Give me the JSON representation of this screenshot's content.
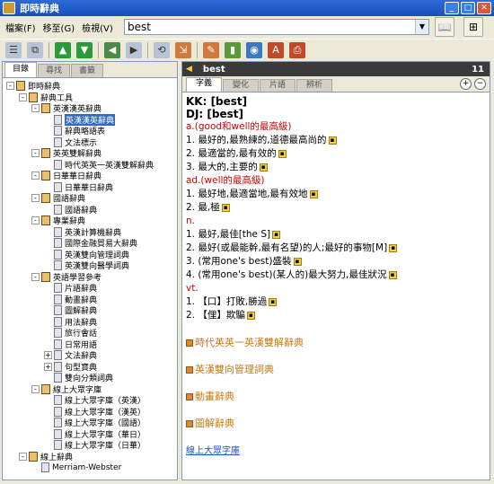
{
  "window": {
    "title": "即時辭典"
  },
  "menu": {
    "items": [
      "檔案(F)",
      "移至(G)",
      "檢視(V)"
    ]
  },
  "search": {
    "value": "best"
  },
  "left_tabs": [
    "目錄",
    "尋找",
    "書籤"
  ],
  "tree": [
    {
      "label": "即時辭典",
      "level": 0,
      "exp": "-",
      "icon": "book"
    },
    {
      "label": "辭典工具",
      "level": 1,
      "exp": "-",
      "icon": "book"
    },
    {
      "label": "英漢漢英辭典",
      "level": 2,
      "exp": "-",
      "icon": "book"
    },
    {
      "label": "英漢漢英辭典",
      "level": 3,
      "icon": "page",
      "selected": true
    },
    {
      "label": "辭典略語表",
      "level": 3,
      "icon": "page"
    },
    {
      "label": "文法標示",
      "level": 3,
      "icon": "page"
    },
    {
      "label": "英英雙解辭典",
      "level": 2,
      "exp": "-",
      "icon": "book"
    },
    {
      "label": "時代英英一英漢雙解辭典",
      "level": 3,
      "icon": "page"
    },
    {
      "label": "日華華日辭典",
      "level": 2,
      "exp": "-",
      "icon": "book"
    },
    {
      "label": "日華華日辭典",
      "level": 3,
      "icon": "page"
    },
    {
      "label": "國語辭典",
      "level": 2,
      "exp": "-",
      "icon": "book"
    },
    {
      "label": "國語辭典",
      "level": 3,
      "icon": "page"
    },
    {
      "label": "專業辭典",
      "level": 2,
      "exp": "-",
      "icon": "book"
    },
    {
      "label": "英漢計算機辭典",
      "level": 3,
      "icon": "page"
    },
    {
      "label": "國際金融貿易大辭典",
      "level": 3,
      "icon": "page"
    },
    {
      "label": "英漢雙向管理詞典",
      "level": 3,
      "icon": "page"
    },
    {
      "label": "英漢雙向醫學詞典",
      "level": 3,
      "icon": "page"
    },
    {
      "label": "英語學習參考",
      "level": 2,
      "exp": "-",
      "icon": "book"
    },
    {
      "label": "片語辭典",
      "level": 3,
      "icon": "page"
    },
    {
      "label": "動畫辭典",
      "level": 3,
      "icon": "page"
    },
    {
      "label": "圖解辭典",
      "level": 3,
      "icon": "page"
    },
    {
      "label": "用法辭典",
      "level": 3,
      "icon": "page"
    },
    {
      "label": "旅行會話",
      "level": 3,
      "icon": "page"
    },
    {
      "label": "日常用語",
      "level": 3,
      "icon": "page"
    },
    {
      "label": "文法辭典",
      "level": 3,
      "exp": "+",
      "icon": "page"
    },
    {
      "label": "句型寶典",
      "level": 3,
      "exp": "+",
      "icon": "page"
    },
    {
      "label": "雙向分類詞典",
      "level": 3,
      "icon": "page"
    },
    {
      "label": "線上大眾字庫",
      "level": 2,
      "exp": "-",
      "icon": "book"
    },
    {
      "label": "線上大眾字庫（英漢）",
      "level": 3,
      "icon": "page"
    },
    {
      "label": "線上大眾字庫（漢英）",
      "level": 3,
      "icon": "page"
    },
    {
      "label": "線上大眾字庫（國語）",
      "level": 3,
      "icon": "page"
    },
    {
      "label": "線上大眾字庫（華日）",
      "level": 3,
      "icon": "page"
    },
    {
      "label": "線上大眾字庫（日華）",
      "level": 3,
      "icon": "page"
    },
    {
      "label": "線上辭典",
      "level": 1,
      "exp": "-",
      "icon": "book"
    },
    {
      "label": "Merriam-Webster",
      "level": 2,
      "icon": "page"
    }
  ],
  "entry": {
    "word": "best",
    "count": "11"
  },
  "right_tabs": [
    "字義",
    "變化",
    "片語",
    "辨析"
  ],
  "content": {
    "kk": "KK: [best]",
    "dj": "DJ: [best]",
    "pos_a": "a.(good和well的最高級)",
    "a_defs": [
      "1. 最好的,最熟練的,道德最高尚的",
      "2. 最適當的,最有效的",
      "3. 最大的,主要的"
    ],
    "pos_ad": "ad.(well的最高級)",
    "ad_defs": [
      "1. 最好地,最適當地,最有效地",
      "2. 最,極"
    ],
    "pos_n": "n.",
    "n_defs": [
      "1. 最好,最佳[the S]",
      "2. 最好(或最能幹,最有名望)的人;最好的事物[M]",
      "3. (常用one's best)盛裝",
      "4. (常用one's best)(某人的)最大努力,最佳狀況"
    ],
    "pos_vt": "vt.",
    "vt_defs": [
      "1. 【口】打敗,勝過",
      "2. 【俚】欺騙"
    ],
    "refs": [
      "時代英英一英漢雙解辭典",
      "英漢雙向管理詞典",
      "動畫辭典",
      "圖解辭典"
    ],
    "link": "線上大眾字庫"
  }
}
